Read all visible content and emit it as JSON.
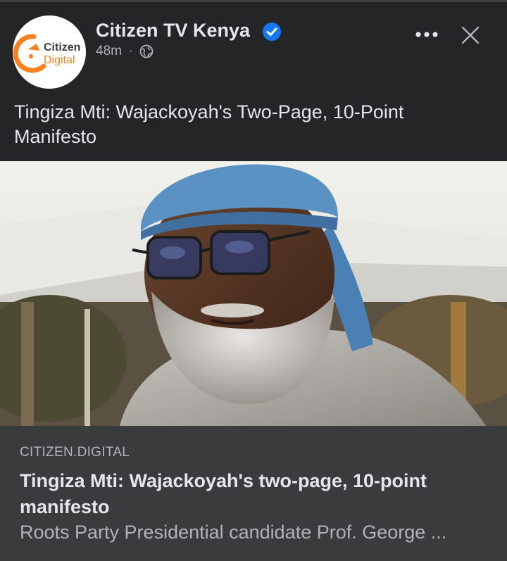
{
  "post": {
    "page_name": "Citizen TV Kenya",
    "verified": true,
    "time": "48m",
    "separator": "·",
    "privacy_icon": "globe-icon",
    "text": "Tingiza Mti: Wajackoyah's Two-Page, 10-Point Manifesto"
  },
  "avatar": {
    "logo_word_1": "Citizen",
    "logo_word_2": "Digital",
    "logo_color": "#f58220"
  },
  "actions": {
    "more_icon": "more-icon",
    "close_icon": "close-icon"
  },
  "link_card": {
    "domain": "CITIZEN.DIGITAL",
    "title": "Tingiza Mti: Wajackoyah's two-page, 10-point manifesto",
    "description": "Roots Party Presidential candidate Prof. George ..."
  },
  "colors": {
    "background": "#242526",
    "card_background": "#3a3b3c",
    "verified_blue": "#1877f2",
    "primary_text": "#e4e6eb",
    "secondary_text": "#b0b3b8"
  }
}
